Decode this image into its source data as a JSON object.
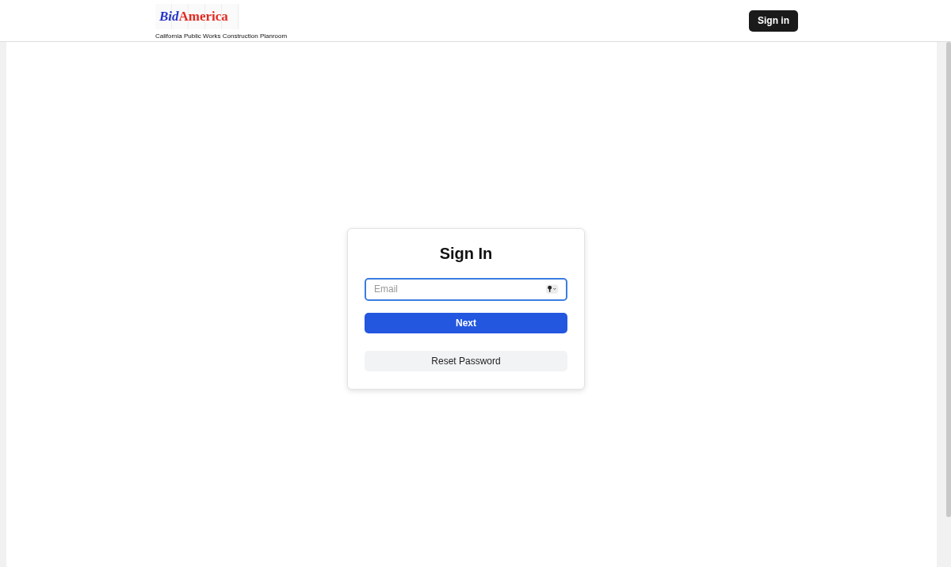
{
  "header": {
    "logo": {
      "first": "Bid",
      "second": "America"
    },
    "tagline": "California Public Works Construction Planroom",
    "sign_in_button": "Sign in"
  },
  "card": {
    "title": "Sign In",
    "email_field": {
      "placeholder": "Email",
      "focused": true
    },
    "next_button": "Next",
    "reset_button": "Reset Password"
  }
}
